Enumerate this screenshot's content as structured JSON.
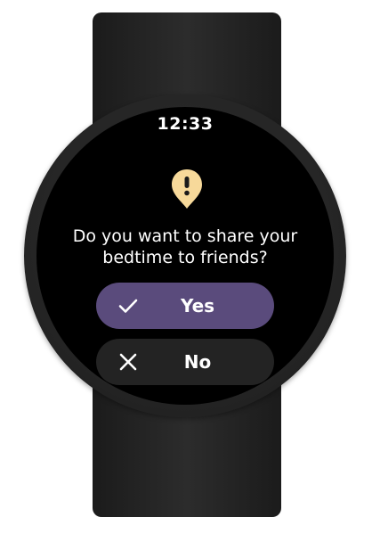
{
  "status": {
    "time": "12:33"
  },
  "dialog": {
    "icon": "alert-pin-icon",
    "message_line1": "Do you want to share your",
    "message_line2": "bedtime to friends?",
    "confirm": {
      "label": "Yes",
      "icon": "check-icon"
    },
    "dismiss": {
      "label": "No",
      "icon": "close-icon"
    }
  },
  "colors": {
    "confirm_button": "#5a4b7c",
    "dismiss_button": "#232323",
    "alert_icon": "#f7d99a",
    "screen": "#000000"
  }
}
